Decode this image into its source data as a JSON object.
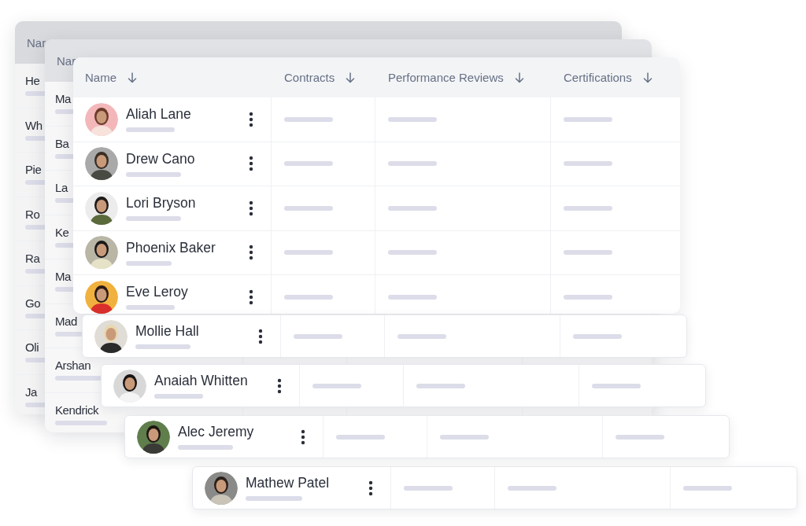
{
  "back_tables": [
    {
      "header": "Nar",
      "rows": [
        "He",
        "Wh",
        "Pie",
        "Ro",
        "Ra",
        "Go",
        "Oli",
        "Ja"
      ]
    },
    {
      "header": "Nar",
      "rows": [
        "Ma",
        "Ba",
        "La",
        "Ke",
        "Ma",
        "Mad",
        "Arshan",
        "Kendrick"
      ]
    }
  ],
  "table": {
    "columns": [
      {
        "label": "Name"
      },
      {
        "label": "Contracts"
      },
      {
        "label": "Performance Reviews"
      },
      {
        "label": "Certifications"
      }
    ],
    "rows": [
      {
        "name": "Aliah Lane"
      },
      {
        "name": "Drew Cano"
      },
      {
        "name": "Lori Bryson"
      },
      {
        "name": "Phoenix Baker"
      },
      {
        "name": "Eve Leroy"
      }
    ]
  },
  "floating_rows": [
    {
      "name": "Mollie Hall"
    },
    {
      "name": "Anaiah Whitten"
    },
    {
      "name": "Alec Jeremy"
    },
    {
      "name": "Mathew Patel"
    }
  ]
}
